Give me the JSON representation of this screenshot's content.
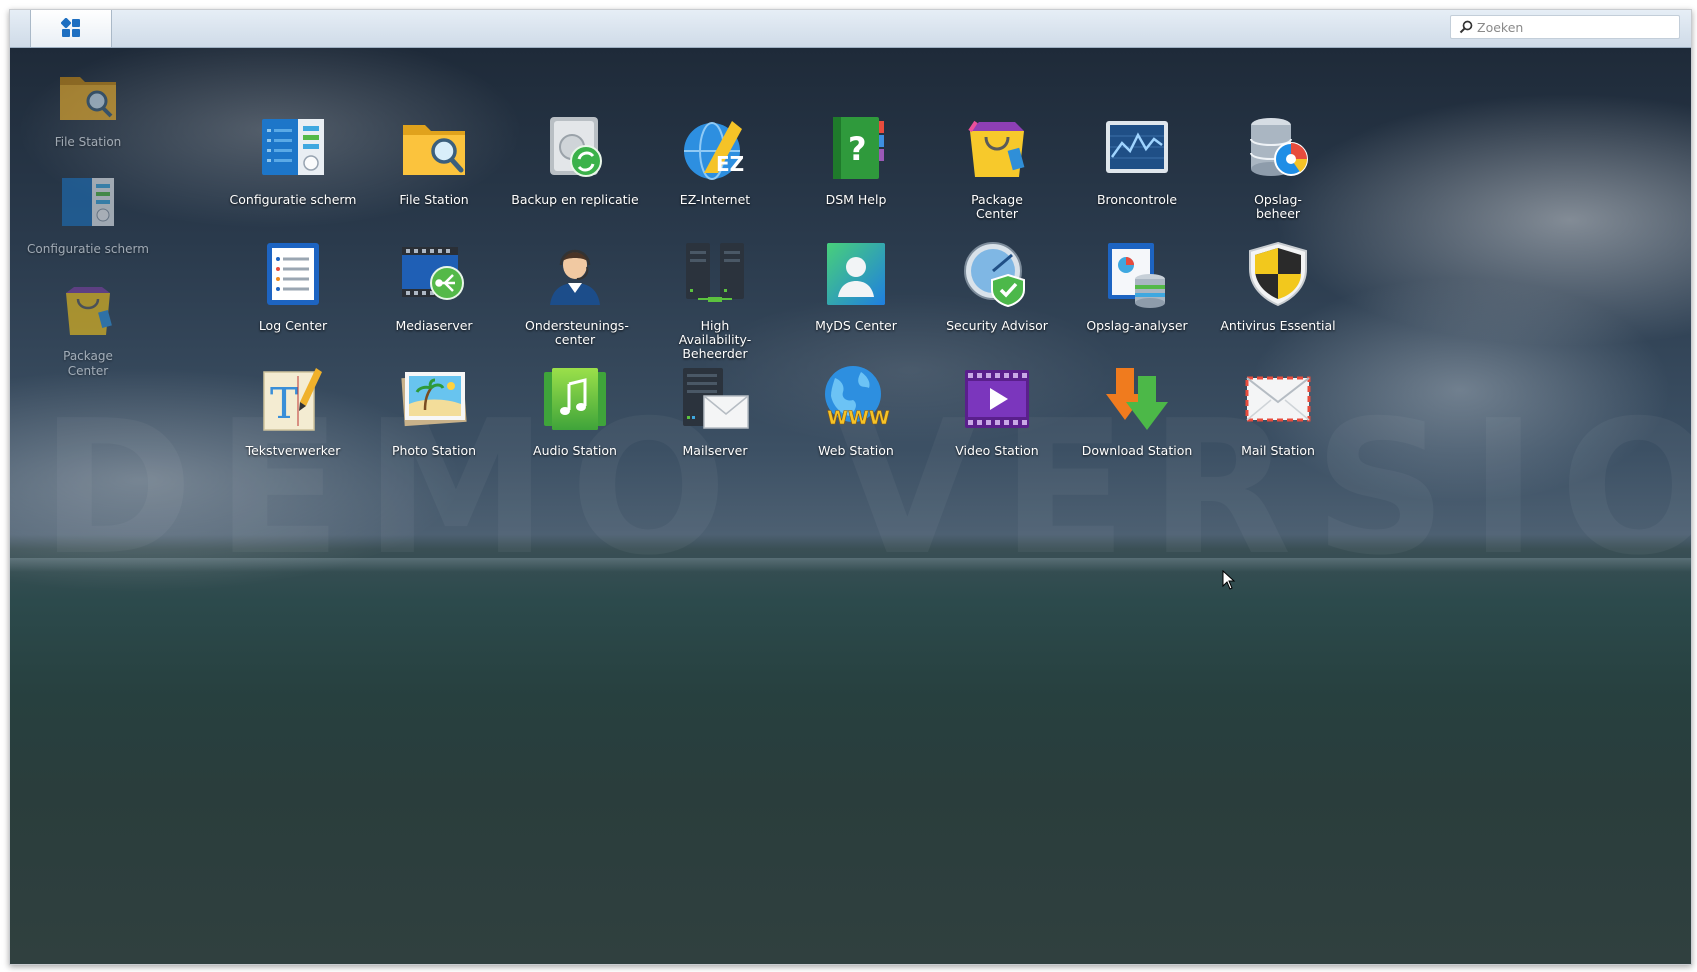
{
  "taskbar": {
    "main_menu_icon": "grid-icon",
    "search": {
      "placeholder": "Zoeken",
      "value": "",
      "icon": "search-icon"
    }
  },
  "desktop_shortcuts": [
    {
      "label": "File Station",
      "icon": "folder-search-icon"
    },
    {
      "label": "Configuratie scherm",
      "icon": "control-panel-icon"
    },
    {
      "label": "Package Center",
      "icon": "shopping-bag-icon"
    }
  ],
  "watermark": "DEMO VERSION",
  "apps": [
    {
      "label": "Configuratie scherm",
      "icon": "control-panel-icon"
    },
    {
      "label": "File Station",
      "icon": "folder-search-icon"
    },
    {
      "label": "Backup en replicatie",
      "icon": "backup-icon"
    },
    {
      "label": "EZ-Internet",
      "icon": "ez-internet-icon"
    },
    {
      "label": "DSM Help",
      "icon": "help-book-icon"
    },
    {
      "label": "Package Center",
      "icon": "shopping-bag-icon"
    },
    {
      "label": "Broncontrole",
      "icon": "resource-monitor-icon"
    },
    {
      "label": "Opslag-beheer",
      "icon": "storage-manager-icon"
    },
    {
      "label": "Log Center",
      "icon": "log-icon"
    },
    {
      "label": "Mediaserver",
      "icon": "media-server-icon"
    },
    {
      "label": "Ondersteunings-center",
      "icon": "support-agent-icon"
    },
    {
      "label": "High Availability-Beheerder",
      "icon": "high-availability-icon"
    },
    {
      "label": "MyDS Center",
      "icon": "myds-user-icon"
    },
    {
      "label": "Security Advisor",
      "icon": "security-shield-icon"
    },
    {
      "label": "Opslag-analyser",
      "icon": "storage-analyzer-icon"
    },
    {
      "label": "Antivirus Essential",
      "icon": "antivirus-shield-icon"
    },
    {
      "label": "Tekstverwerker",
      "icon": "text-editor-icon"
    },
    {
      "label": "Photo Station",
      "icon": "photo-icon"
    },
    {
      "label": "Audio Station",
      "icon": "music-note-icon"
    },
    {
      "label": "Mailserver",
      "icon": "mail-server-icon"
    },
    {
      "label": "Web Station",
      "icon": "globe-www-icon"
    },
    {
      "label": "Video Station",
      "icon": "video-play-icon"
    },
    {
      "label": "Download Station",
      "icon": "download-arrow-icon"
    },
    {
      "label": "Mail Station",
      "icon": "mail-envelope-icon"
    }
  ],
  "colors": {
    "taskbar": "#d9e4ef",
    "label_text": "#ffffff"
  }
}
